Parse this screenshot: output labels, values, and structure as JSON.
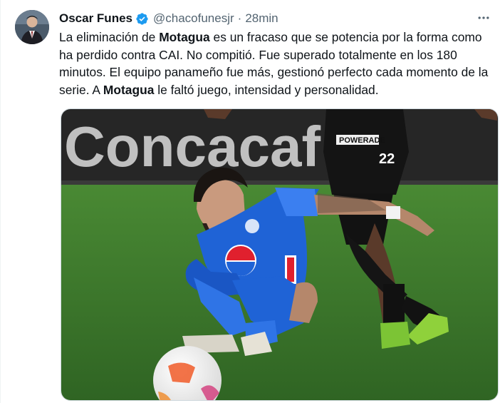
{
  "author": {
    "name": "Oscar Funes",
    "handle": "@chacofunesjr",
    "separator": "·",
    "time": "28min",
    "verified": true,
    "avatar_icon": "profile-photo"
  },
  "tweet": {
    "t1": "La eliminación de ",
    "b1": "Motagua",
    "t2": " es un fracaso  que se potencia por la forma como ha perdido contra CAI. No compitió. Fue superado totalmente en los 180 minutos. El equipo panameño fue más, gestionó perfecto cada momento de la serie. A ",
    "b2": "Motagua",
    "t3": " le faltó juego, intensidad y personalidad."
  },
  "media": {
    "banner_text": "Concacaf",
    "sponsor_text": "POWERADE",
    "player_number": "22",
    "colors": {
      "pitch": "#3f7a2e",
      "banner": "#2a2a2a",
      "motagua_blue": "#1f63d6",
      "cai_black": "#141414"
    }
  },
  "colors": {
    "verified": "#1d9bf0",
    "secondary_text": "#536471",
    "primary_text": "#0f1419"
  },
  "icons": {
    "verified": "verified-badge-icon",
    "more": "more-options-icon"
  }
}
